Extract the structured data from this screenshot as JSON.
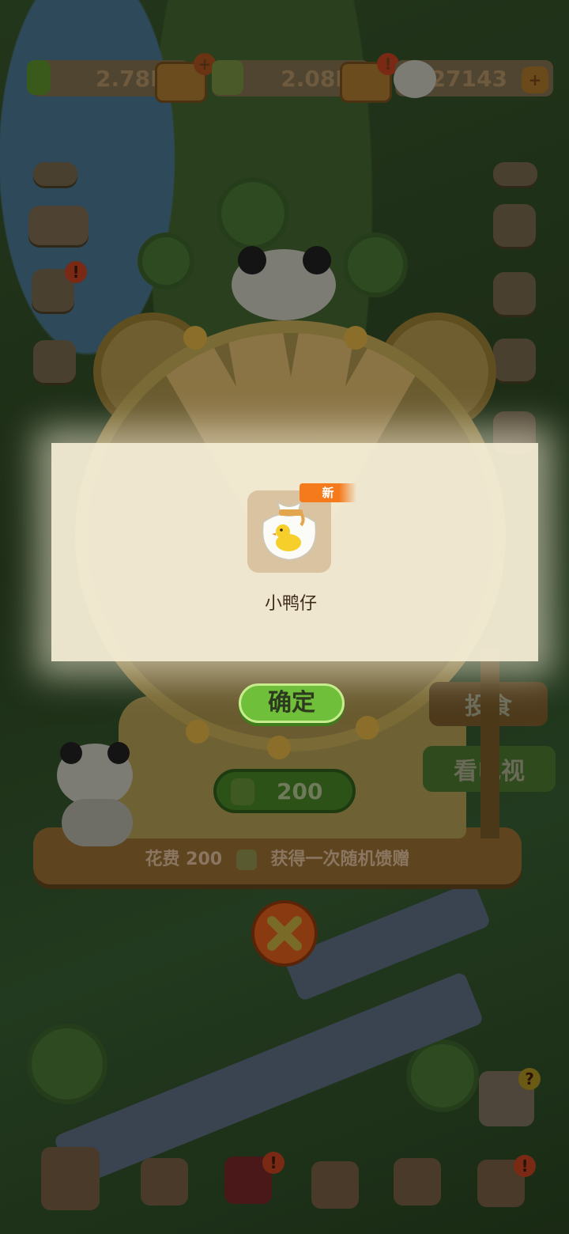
{
  "resources": {
    "bamboo_amount": "2.78M",
    "shoots_amount": "2.08K",
    "panda_amount": "27143"
  },
  "dialog": {
    "new_badge": "新",
    "item_name": "小鸭仔",
    "confirm_label": "确定"
  },
  "wheel": {
    "cost_value": "200",
    "cost_note_prefix": "花费 200",
    "cost_note_suffix": "获得一次随机馈赠"
  },
  "signs": {
    "feed_label": "投食",
    "tv_label": "看电视"
  },
  "alerts": {
    "badge": "!",
    "plus": "+",
    "help": "?"
  },
  "colors": {
    "overlay_panel": "#f5eed7",
    "confirm_green": "#6fbf3a",
    "new_badge_orange": "#f57a1c",
    "close_orange": "#8a3a10"
  },
  "icons": {
    "bamboo": "bamboo-icon",
    "shoot": "bamboo-shoot-icon",
    "panda": "panda-icon",
    "shop": "shop-stall-icon",
    "item": "duck-sack-icon",
    "close": "close-x-icon"
  }
}
